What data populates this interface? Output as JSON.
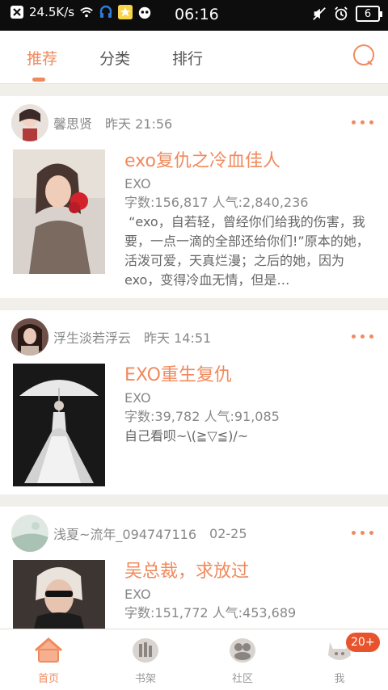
{
  "status_bar": {
    "net_speed": "24.5K/s",
    "time": "06:16",
    "battery": "6",
    "icons": [
      "x-box-icon",
      "wifi-icon",
      "headset-icon",
      "star-badge-icon",
      "owl-icon",
      "mute-icon",
      "alarm-icon",
      "battery-icon"
    ]
  },
  "top_nav": {
    "tabs": [
      {
        "label": "推荐",
        "active": true
      },
      {
        "label": "分类",
        "active": false
      },
      {
        "label": "排行",
        "active": false
      }
    ],
    "search_icon": "search-icon"
  },
  "posts": [
    {
      "author": "馨思贤",
      "time": "昨天 21:56",
      "title": "exo复仇之冷血佳人",
      "tag": "EXO",
      "stats": "字数:156,817  人气:2,840,236",
      "desc": " “exo，自若轻，曾经你们给我的伤害，我要，一点一滴的全部还给你们!”原本的她，活泼可爱，天真烂漫；之后的她，因为exo，变得冷血无情，但是…"
    },
    {
      "author": "浮生淡若浮云",
      "time": "昨天 14:51",
      "title": "EXO重生复仇",
      "tag": "EXO",
      "stats": "字数:39,782  人气:91,085",
      "desc": "自己看呗~\\(≧▽≦)/~"
    },
    {
      "author": "浅夏~流年_094747116",
      "time": "02-25",
      "title": "吴总裁，求放过",
      "tag": "EXO",
      "stats": "字数:151,772  人气:453,689",
      "desc": ""
    }
  ],
  "bottom_nav": {
    "items": [
      {
        "label": "首页",
        "icon": "home-icon",
        "active": true
      },
      {
        "label": "书架",
        "icon": "bookshelf-icon",
        "active": false
      },
      {
        "label": "社区",
        "icon": "community-icon",
        "active": false
      },
      {
        "label": "我",
        "icon": "me-cat-icon",
        "active": false
      }
    ],
    "badge": "20+"
  },
  "colors": {
    "accent": "#f08a5d",
    "badge": "#e9532c",
    "background": "#f1efea"
  }
}
